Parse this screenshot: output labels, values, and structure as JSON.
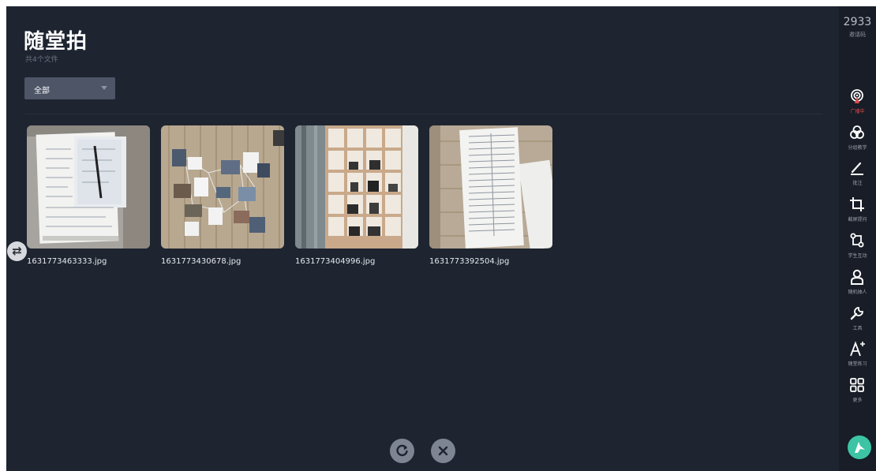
{
  "header": {
    "title": "随堂拍",
    "subtitle": "共4个文件"
  },
  "filter": {
    "selected": "全部"
  },
  "files": [
    {
      "name": "1631773463333.jpg",
      "thumb": "document-photo"
    },
    {
      "name": "1631773430678.jpg",
      "thumb": "photo-wall"
    },
    {
      "name": "1631773404996.jpg",
      "thumb": "shelf-photo"
    },
    {
      "name": "1631773392504.jpg",
      "thumb": "form-photo"
    }
  ],
  "sidebar": {
    "invite_code": "2933",
    "invite_label": "邀请码",
    "tools": [
      {
        "label": "广播中",
        "icon": "broadcast-icon",
        "active": true,
        "color": "#e04848"
      },
      {
        "label": "分组教学",
        "icon": "group-icon"
      },
      {
        "label": "批注",
        "icon": "pen-icon"
      },
      {
        "label": "截屏提问",
        "icon": "crop-icon"
      },
      {
        "label": "学生互动",
        "icon": "interaction-icon"
      },
      {
        "label": "随机抽人",
        "icon": "person-icon"
      },
      {
        "label": "工具",
        "icon": "wrench-icon"
      },
      {
        "label": "随堂练习",
        "icon": "quiz-icon"
      },
      {
        "label": "更多",
        "icon": "grid-icon"
      }
    ]
  },
  "colors": {
    "background": "#1e2430",
    "sidebar": "#181d27",
    "accent_logo": "#3cc4a4",
    "active_tool": "#e04848"
  }
}
